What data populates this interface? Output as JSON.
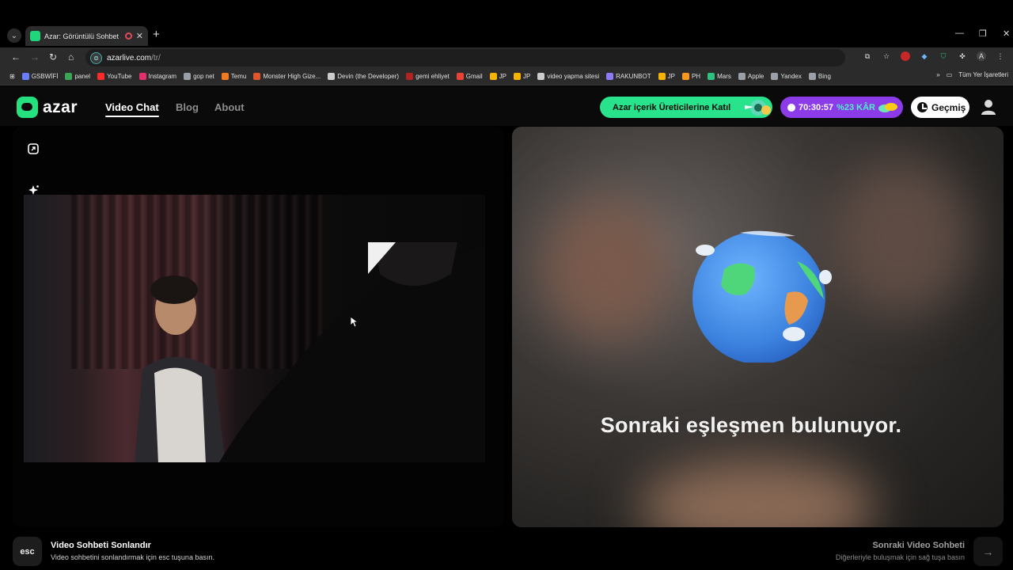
{
  "browser": {
    "tab_title": "Azar: Görüntülü Sohbet & Vi",
    "new_tab_icon": "+",
    "url_host": "azarlive.com",
    "url_path": "/tr/",
    "bookmarks": [
      {
        "label": "GSBWİFİ",
        "color": "#6a7cff"
      },
      {
        "label": "panel",
        "color": "#3aa655"
      },
      {
        "label": "YouTube",
        "color": "#ff2a2a"
      },
      {
        "label": "Instagram",
        "color": "#e1306c"
      },
      {
        "label": "gop net",
        "color": "#9aa0a6"
      },
      {
        "label": "Temu",
        "color": "#f47a20"
      },
      {
        "label": "Monster High Gize...",
        "color": "#e0552b"
      },
      {
        "label": "Devin (the Developer)",
        "color": "#cccccc"
      },
      {
        "label": "gemi ehliyet",
        "color": "#b22222"
      },
      {
        "label": "Gmail",
        "color": "#ea4335"
      },
      {
        "label": "JP",
        "color": "#f4b400"
      },
      {
        "label": "JP",
        "color": "#f4b400"
      },
      {
        "label": "video yapma sitesi",
        "color": "#cccccc"
      },
      {
        "label": "RAKUNBOT",
        "color": "#8b7cf6"
      },
      {
        "label": "JP",
        "color": "#f4b400"
      },
      {
        "label": "PH",
        "color": "#f7971e"
      },
      {
        "label": "Mars",
        "color": "#2ec27e"
      },
      {
        "label": "Apple",
        "color": "#9aa0a6"
      },
      {
        "label": "Yandex",
        "color": "#9aa0a6"
      },
      {
        "label": "Bing",
        "color": "#9aa0a6"
      }
    ],
    "bookmarks_more": "»",
    "all_bookmarks": "Tüm Yer İşaretleri"
  },
  "header": {
    "logo_text": "azar",
    "nav": [
      {
        "label": "Video Chat",
        "active": true
      },
      {
        "label": "Blog",
        "active": false
      },
      {
        "label": "About",
        "active": false
      }
    ],
    "creator_button": "Azar içerik Üreticilerine Katıl",
    "timer": "70:30:57",
    "discount": "%23 KÂR",
    "history_button": "Geçmiş"
  },
  "colors": {
    "accent_green": "#28e38b",
    "accent_purple": "#8b3ce8",
    "discount_cyan": "#4ff0c4"
  },
  "left_panel": {
    "tools": [
      "fullscreen-icon",
      "effects-sparkle-icon",
      "sticker-icon"
    ]
  },
  "right_panel": {
    "status_text": "Sonraki eşleşmen bulunuyor."
  },
  "footer": {
    "esc_key": "esc",
    "end_title": "Video Sohbeti Sonlandır",
    "end_subtitle": "Video sohbetini sonlandırmak için esc tuşuna basın.",
    "next_title": "Sonraki Video Sohbeti",
    "next_subtitle": "Diğerleriyle buluşmak için sağ tuşa basın",
    "next_arrow": "→"
  }
}
